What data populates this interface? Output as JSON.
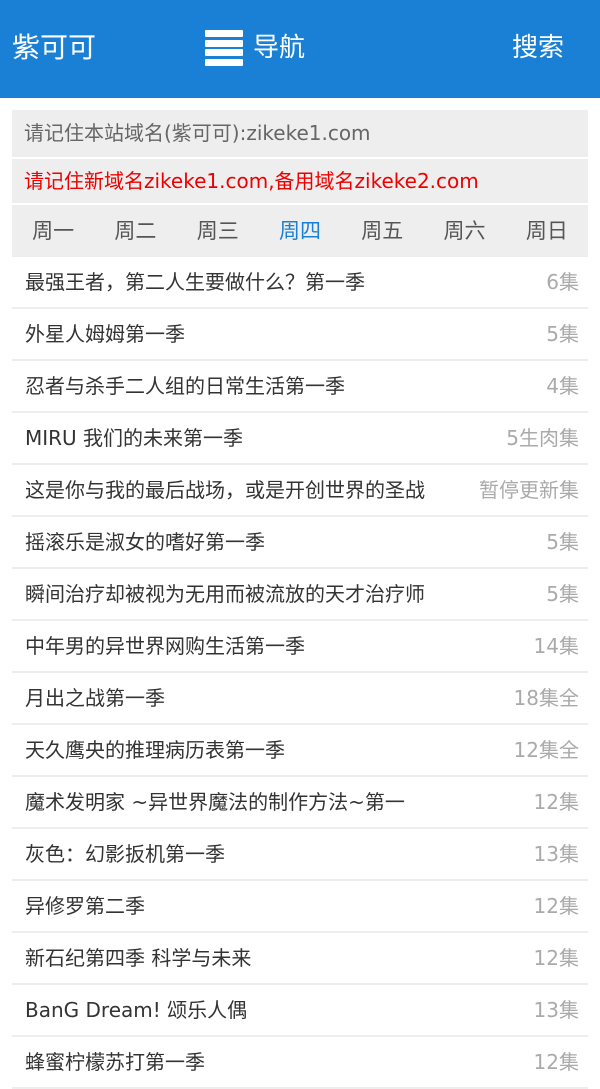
{
  "header": {
    "site_title": "紫可可",
    "nav_label": "导航",
    "search_label": "搜索"
  },
  "notices": {
    "domain_reminder": "请记住本站域名(紫可可):zikeke1.com",
    "new_domain": "请记住新域名zikeke1.com,备用域名zikeke2.com"
  },
  "tabs": [
    "周一",
    "周二",
    "周三",
    "周四",
    "周五",
    "周六",
    "周日"
  ],
  "active_tab": "周四",
  "list": [
    {
      "title": "最强王者，第二人生要做什么？第一季",
      "eps": "6集"
    },
    {
      "title": "外星人姆姆第一季",
      "eps": "5集"
    },
    {
      "title": "忍者与杀手二人组的日常生活第一季",
      "eps": "4集"
    },
    {
      "title": "MIRU 我们的未来第一季",
      "eps": "5生肉集"
    },
    {
      "title": "这是你与我的最后战场，或是开创世界的圣战",
      "eps": "暂停更新集"
    },
    {
      "title": "摇滚乐是淑女的嗜好第一季",
      "eps": "5集"
    },
    {
      "title": "瞬间治疗却被视为无用而被流放的天才治疗师",
      "eps": "5集"
    },
    {
      "title": "中年男的异世界网购生活第一季",
      "eps": "14集"
    },
    {
      "title": "月出之战第一季",
      "eps": "18集全"
    },
    {
      "title": "天久鹰央的推理病历表第一季",
      "eps": "12集全"
    },
    {
      "title": "魔术发明家 ~异世界魔法的制作方法~第一",
      "eps": "12集"
    },
    {
      "title": "灰色：幻影扳机第一季",
      "eps": "13集"
    },
    {
      "title": "异修罗第二季",
      "eps": "12集"
    },
    {
      "title": "新石纪第四季 科学与未来",
      "eps": "12集"
    },
    {
      "title": "BanG Dream! 颂乐人偶",
      "eps": "13集"
    },
    {
      "title": "蜂蜜柠檬苏打第一季",
      "eps": "12集"
    }
  ],
  "colors": {
    "brand": "#1a80d5",
    "notice_red": "#ee0000",
    "episode_gray": "#aaaaaa"
  }
}
